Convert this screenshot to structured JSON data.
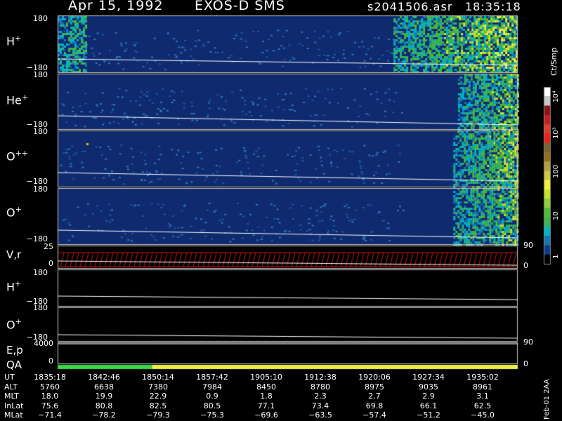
{
  "header": {
    "date": "Apr 15, 1992",
    "instrument": "EXOS-D SMS",
    "file": "s2041506.asr",
    "time": "18:35:18"
  },
  "panels": [
    {
      "id": "hplus",
      "species": "H",
      "charge": "+",
      "tick_top": "180",
      "tick_bottom": "−180"
    },
    {
      "id": "heplus",
      "species": "He",
      "charge": "+",
      "tick_top": "180",
      "tick_bottom": "−180"
    },
    {
      "id": "oplusplus",
      "species": "O",
      "charge": "++",
      "tick_top": "180",
      "tick_bottom": "−180"
    },
    {
      "id": "oplus",
      "species": "O",
      "charge": "+",
      "tick_top": "180",
      "tick_bottom": "−180"
    }
  ],
  "vr_panel": {
    "label": "V,r",
    "tick_top": "25",
    "tick_bottom": "0",
    "right_top": "90",
    "right_bottom": "0"
  },
  "line_panels": [
    {
      "id": "hplus-line",
      "species": "H",
      "charge": "+",
      "tick_top": "180",
      "tick_bottom": "−180"
    },
    {
      "id": "oplus-line",
      "species": "O",
      "charge": "+",
      "tick_top": "180",
      "tick_bottom": "−180"
    }
  ],
  "ep_panel": {
    "label": "E,p",
    "tick_top": "4000",
    "tick_bottom": "0",
    "right": "90"
  },
  "qa_panel": {
    "label": "QA",
    "right": "0",
    "colors": [
      "#3ad64a",
      "#f0ee46"
    ],
    "green_fraction": 0.205
  },
  "colorbar": {
    "unit": "Ct/Smp",
    "labels": [
      "10⁴",
      "10³",
      "100",
      "10",
      "1"
    ],
    "colors": [
      "#ffffff",
      "#c8c8c8",
      "#8c1414",
      "#c81e1e",
      "#e03c2c",
      "#f01e1e",
      "#786432",
      "#966e1e",
      "#b4a03c",
      "#d2c846",
      "#f0f03c",
      "#c8e628",
      "#8cd23c",
      "#50be32",
      "#3cb450",
      "#00b4c8",
      "#1478b4",
      "#0a3c8c",
      "#000000"
    ]
  },
  "colors": {
    "background": "#0f2a6e",
    "frame": "#c8c8c8",
    "trace": "#ffffff",
    "vr_fill": "#c81414"
  },
  "ephemeris": {
    "rows": [
      {
        "label": "UT",
        "values": [
          "1835:18",
          "1842:46",
          "1850:14",
          "1857:42",
          "1905:10",
          "1912:38",
          "1920:06",
          "1927:34",
          "1935:02"
        ]
      },
      {
        "label": "ALT",
        "values": [
          "5760",
          "6638",
          "7380",
          "7984",
          "8450",
          "8780",
          "8975",
          "9035",
          "8961"
        ]
      },
      {
        "label": "MLT",
        "values": [
          "18.0",
          "19.9",
          "22.9",
          "0.9",
          "1.8",
          "2.3",
          "2.7",
          "2.9",
          "3.1"
        ]
      },
      {
        "label": "InLat",
        "values": [
          "75.6",
          "80.8",
          "82.5",
          "80.5",
          "77.1",
          "73.4",
          "69.8",
          "66.1",
          "62.5"
        ]
      },
      {
        "label": "MLat",
        "values": [
          "−71.4",
          "−78.2",
          "−79.3",
          "−75.3",
          "−69.6",
          "−63.5",
          "−57.4",
          "−51.2",
          "−45.0"
        ]
      }
    ],
    "footer": "Feb-01 2AA"
  }
}
